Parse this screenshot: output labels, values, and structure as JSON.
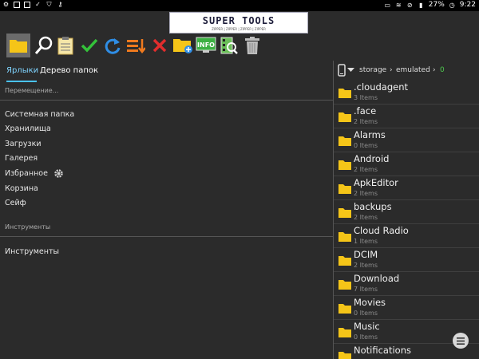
{
  "status_bar": {
    "battery_percent": "27%",
    "time": "9:22",
    "left_icons": [
      "gear-icon",
      "image-icon",
      "image-icon",
      "check-icon",
      "shield-icon",
      "key-icon"
    ],
    "right_icons": [
      "cast-icon",
      "wifi-icon",
      "mute-icon"
    ]
  },
  "banner": {
    "title": "SUPER TOOLS",
    "subtitle": "ZIPPER | ZIPPER | ZIPPER | ZIPPER"
  },
  "toolbar": {
    "buttons": [
      {
        "icon": "folder-icon",
        "color": "#f5c518"
      },
      {
        "icon": "search-icon",
        "color": "#ffffff"
      },
      {
        "icon": "clipboard-icon",
        "color": "#f5e6a8"
      },
      {
        "icon": "check-icon",
        "color": "#34c23a"
      },
      {
        "icon": "refresh-icon",
        "color": "#2f8ee6"
      },
      {
        "icon": "sort-icon",
        "color": "#f07a1e"
      },
      {
        "icon": "close-icon",
        "color": "#e12d2d"
      },
      {
        "icon": "new-folder-icon",
        "color": "#f5c518"
      },
      {
        "icon": "info-icon",
        "color": "#3cb043",
        "label": "INFO"
      },
      {
        "icon": "media-search-icon",
        "color": "#6bbf59"
      },
      {
        "icon": "trash-icon",
        "color": "#bdbdbd"
      }
    ]
  },
  "left_panel": {
    "tabs": [
      "Ярлыки",
      "Дерево папок"
    ],
    "section_move": "Перемещение...",
    "items": [
      "Системная папка",
      "Хранилища",
      "Загрузки",
      "Галерея",
      "Избранное",
      "Корзина",
      "Сейф"
    ],
    "section_tools": "Инструменты",
    "tools_items": [
      "Инструменты"
    ]
  },
  "right_panel": {
    "breadcrumb": [
      "storage",
      "emulated",
      "0"
    ],
    "folders": [
      {
        "name": ".cloudagent",
        "count": "3 Items"
      },
      {
        "name": ".face",
        "count": "2 Items"
      },
      {
        "name": "Alarms",
        "count": "0 Items"
      },
      {
        "name": "Android",
        "count": "2 Items"
      },
      {
        "name": "ApkEditor",
        "count": "2 Items"
      },
      {
        "name": "backups",
        "count": "2 Items"
      },
      {
        "name": "Cloud Radio",
        "count": "1 Items"
      },
      {
        "name": "DCIM",
        "count": "2 Items"
      },
      {
        "name": "Download",
        "count": "7 Items"
      },
      {
        "name": "Movies",
        "count": "0 Items"
      },
      {
        "name": "Music",
        "count": "0 Items"
      },
      {
        "name": "Notifications",
        "count": ""
      }
    ]
  },
  "colors": {
    "background": "#2b2b2b",
    "accent": "#4ac3ff",
    "folder": "#f5c518",
    "breadcrumb_active": "#4ec94e"
  }
}
